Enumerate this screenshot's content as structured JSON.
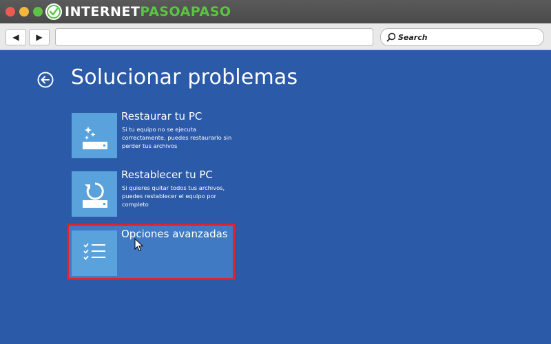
{
  "browser": {
    "brand": {
      "part1": "INTERNET",
      "part2": "PASOAPASO"
    },
    "nav": {
      "back_glyph": "◀",
      "forward_glyph": "▶"
    },
    "address": {
      "value": ""
    },
    "search": {
      "placeholder": "Search"
    }
  },
  "page": {
    "title": "Solucionar problemas",
    "options": [
      {
        "title": "Restaurar tu PC",
        "description": "Si tu equipo no se ejecuta correctamente, puedes restaurarlo sin perder tus archivos",
        "icon": "restore-icon"
      },
      {
        "title": "Restablecer tu PC",
        "description": "Si quieres quitar todos tus archivos, puedes restablecer el equipo por completo",
        "icon": "reset-icon"
      },
      {
        "title": "Opciones avanzadas",
        "description": "",
        "icon": "checklist-icon",
        "highlighted": true
      }
    ]
  },
  "colors": {
    "background": "#2a5aa8",
    "tile": "#5aa2dc",
    "highlight": "#e0222a",
    "brand_green": "#5cc443"
  }
}
